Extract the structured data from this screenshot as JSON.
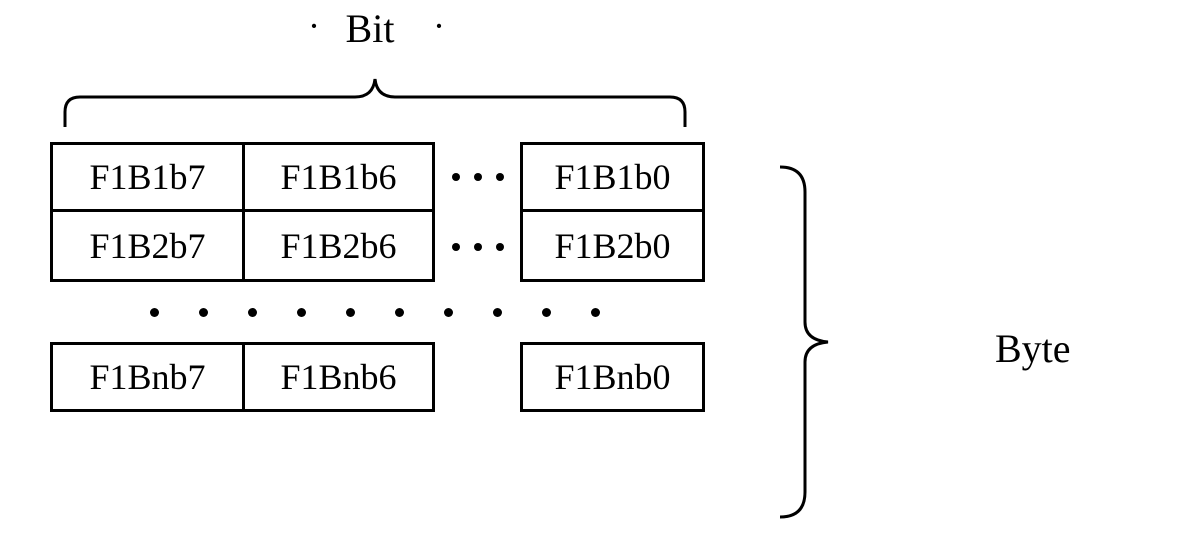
{
  "labels": {
    "bit": "Bit",
    "byte": "Byte",
    "mid_dot": "·"
  },
  "grid": {
    "row1": {
      "c1": "F1B1b7",
      "c2": "F1B1b6",
      "c3": "F1B1b0"
    },
    "row2": {
      "c1": "F1B2b7",
      "c2": "F1B2b6",
      "c3": "F1B2b0"
    },
    "rowN": {
      "c1": "F1Bnb7",
      "c2": "F1Bnb6",
      "c3": "F1Bnb0"
    }
  }
}
